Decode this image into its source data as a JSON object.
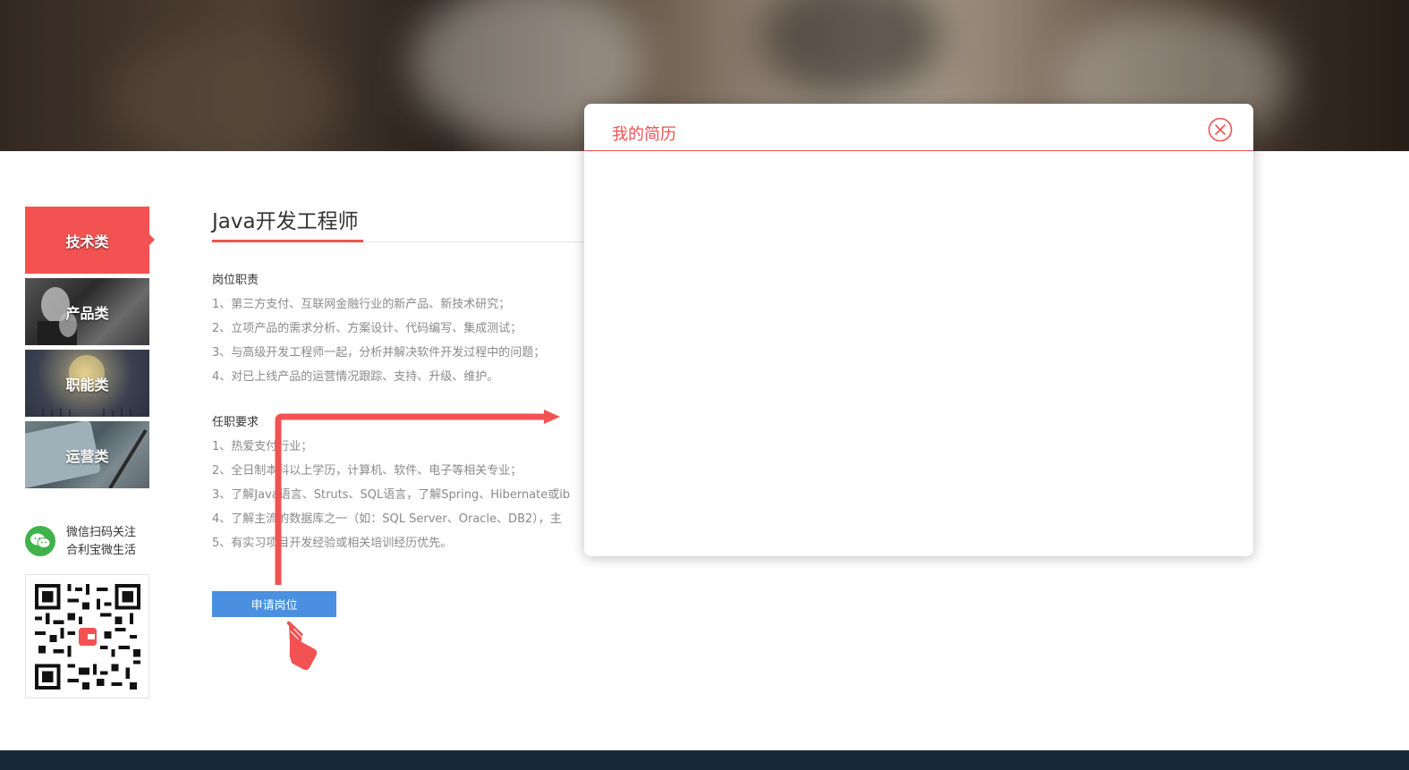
{
  "sidebar": {
    "categories": [
      {
        "label": "技术类",
        "active": true
      },
      {
        "label": "产品类",
        "active": false
      },
      {
        "label": "职能类",
        "active": false
      },
      {
        "label": "运营类",
        "active": false
      }
    ],
    "wechat": {
      "line1": "微信扫码关注",
      "line2": "合利宝微生活",
      "icon": "wechat-icon"
    }
  },
  "job": {
    "title": "Java开发工程师",
    "duties_heading": "岗位职责",
    "duties": [
      "1、第三方支付、互联网金融行业的新产品、新技术研究；",
      "2、立项产品的需求分析、方案设计、代码编写、集成测试；",
      "3、与高级开发工程师一起，分析并解决软件开发过程中的问题；",
      "4、对已上线产品的运营情况跟踪、支持、升级、维护。"
    ],
    "requirements_heading": "任职要求",
    "requirements": [
      "1、热爱支付行业；",
      "2、全日制本科以上学历，计算机、软件、电子等相关专业；",
      "3、了解Java语言、Struts、SQL语言，了解Spring、Hibernate或ib",
      "4、了解主流的数据库之一（如：SQL Server、Oracle、DB2），主",
      "5、有实习项目开发经验或相关培训经历优先。"
    ],
    "apply_label": "申请岗位"
  },
  "modal": {
    "title": "我的简历",
    "close_icon": "close-circle-icon"
  },
  "colors": {
    "accent": "#f25252",
    "button": "#4a8fe0",
    "footer": "#172836",
    "wechat": "#3fb24b"
  }
}
